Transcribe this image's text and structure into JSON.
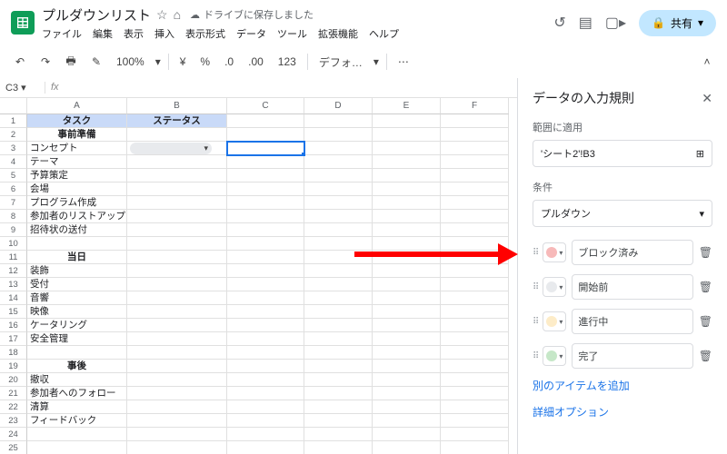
{
  "header": {
    "doc_title": "プルダウンリスト",
    "save_status": "ドライブに保存しました",
    "share_label": "共有",
    "menus": [
      "ファイル",
      "編集",
      "表示",
      "挿入",
      "表示形式",
      "データ",
      "ツール",
      "拡張機能",
      "ヘルプ"
    ]
  },
  "toolbar": {
    "zoom": "100%",
    "currency": "¥",
    "percent": "%",
    "dec_minus": ".0",
    "dec_plus": ".00",
    "numfmt": "123",
    "font": "デフォ…"
  },
  "cellref": "C3",
  "columns": [
    "A",
    "B",
    "C",
    "D",
    "E",
    "F"
  ],
  "rows": [
    {
      "n": 1,
      "a": "タスク",
      "b": "ステータス",
      "header": true
    },
    {
      "n": 2,
      "a": "事前準備",
      "bold": true
    },
    {
      "n": 3,
      "a": "コンセプト",
      "chip": true,
      "selectedC": true
    },
    {
      "n": 4,
      "a": "テーマ"
    },
    {
      "n": 5,
      "a": "予算策定"
    },
    {
      "n": 6,
      "a": "会場"
    },
    {
      "n": 7,
      "a": "プログラム作成"
    },
    {
      "n": 8,
      "a": "参加者のリストアップ"
    },
    {
      "n": 9,
      "a": "招待状の送付"
    },
    {
      "n": 10,
      "a": ""
    },
    {
      "n": 11,
      "a": "当日",
      "bold": true
    },
    {
      "n": 12,
      "a": "装飾"
    },
    {
      "n": 13,
      "a": "受付"
    },
    {
      "n": 14,
      "a": "音響"
    },
    {
      "n": 15,
      "a": "映像"
    },
    {
      "n": 16,
      "a": "ケータリング"
    },
    {
      "n": 17,
      "a": "安全管理"
    },
    {
      "n": 18,
      "a": ""
    },
    {
      "n": 19,
      "a": "事後",
      "bold": true
    },
    {
      "n": 20,
      "a": "撤収"
    },
    {
      "n": 21,
      "a": "参加者へのフォロー"
    },
    {
      "n": 22,
      "a": "清算"
    },
    {
      "n": 23,
      "a": "フィードバック"
    },
    {
      "n": 24,
      "a": ""
    },
    {
      "n": 25,
      "a": ""
    }
  ],
  "sidepanel": {
    "title": "データの入力規則",
    "range_label": "範囲に適用",
    "range_value": "'シート2'!B3",
    "criteria_label": "条件",
    "criteria_value": "プルダウン",
    "options": [
      {
        "color": "#f7b9b9",
        "label": "ブロック済み"
      },
      {
        "color": "#e8eaed",
        "label": "開始前"
      },
      {
        "color": "#fdecc8",
        "label": "進行中"
      },
      {
        "color": "#c6e7c8",
        "label": "完了"
      }
    ],
    "add_item": "別のアイテムを追加",
    "advanced": "詳細オプション"
  }
}
